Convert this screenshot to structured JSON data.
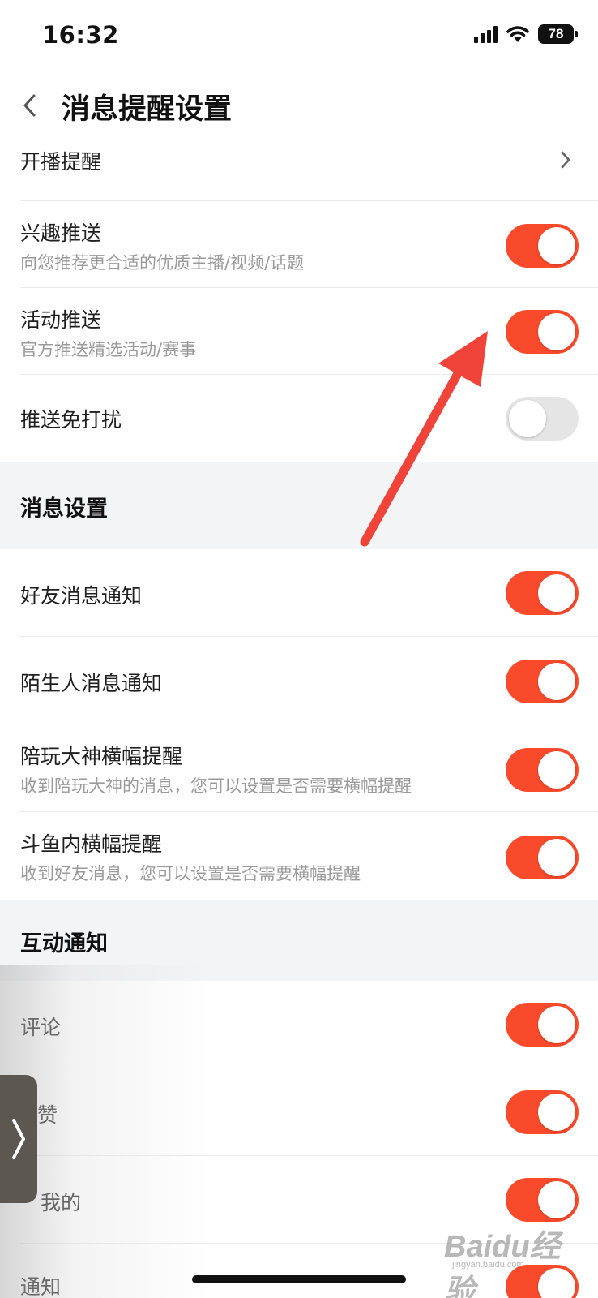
{
  "status_bar": {
    "time": "16:32",
    "battery": "78"
  },
  "header": {
    "title": "消息提醒设置"
  },
  "push_settings": {
    "rows": [
      {
        "label": "开播提醒"
      },
      {
        "label": "兴趣推送",
        "subtitle": "向您推荐更合适的优质主播/视频/话题",
        "enabled": true
      },
      {
        "label": "活动推送",
        "subtitle": "官方推送精选活动/赛事",
        "enabled": true
      },
      {
        "label": "推送免打扰",
        "enabled": false
      }
    ]
  },
  "message_settings": {
    "title": "消息设置",
    "rows": [
      {
        "label": "好友消息通知",
        "enabled": true
      },
      {
        "label": "陌生人消息通知",
        "enabled": true
      },
      {
        "label": "陪玩大神横幅提醒",
        "subtitle": "收到陪玩大神的消息，您可以设置是否需要横幅提醒",
        "enabled": true
      },
      {
        "label": "斗鱼内横幅提醒",
        "subtitle": "收到好友消息，您可以设置是否需要横幅提醒",
        "enabled": true
      }
    ]
  },
  "interaction_notifications": {
    "title": "互动通知",
    "rows": [
      {
        "label": "评论",
        "enabled": true
      },
      {
        "label": "赞",
        "enabled": true
      },
      {
        "label": "我的",
        "enabled": true
      },
      {
        "label": "通知",
        "enabled": true
      }
    ]
  },
  "watermark": {
    "logo": "Baidu经验",
    "sub": "jingyan.baidu.com"
  },
  "colors": {
    "accent": "#fa4a2c",
    "toggle_off": "#e5e5e5",
    "section_bg": "#f3f4f6",
    "annotation_arrow": "#f0433a"
  }
}
